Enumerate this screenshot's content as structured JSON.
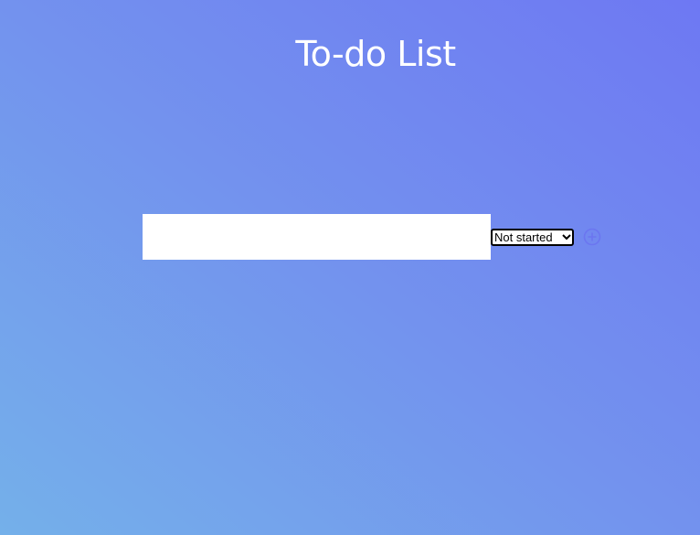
{
  "header": {
    "title": "To-do List"
  },
  "form": {
    "task_input": {
      "value": "",
      "placeholder": ""
    },
    "status": {
      "selected": "Not started"
    },
    "add_icon": "plus-circle-icon"
  },
  "colors": {
    "gradient_top_right": "#6e78f3",
    "gradient_bottom_left": "#74b0ea",
    "title_text": "#ffffff",
    "add_icon": "#6b76f0",
    "input_background": "#ffffff"
  }
}
